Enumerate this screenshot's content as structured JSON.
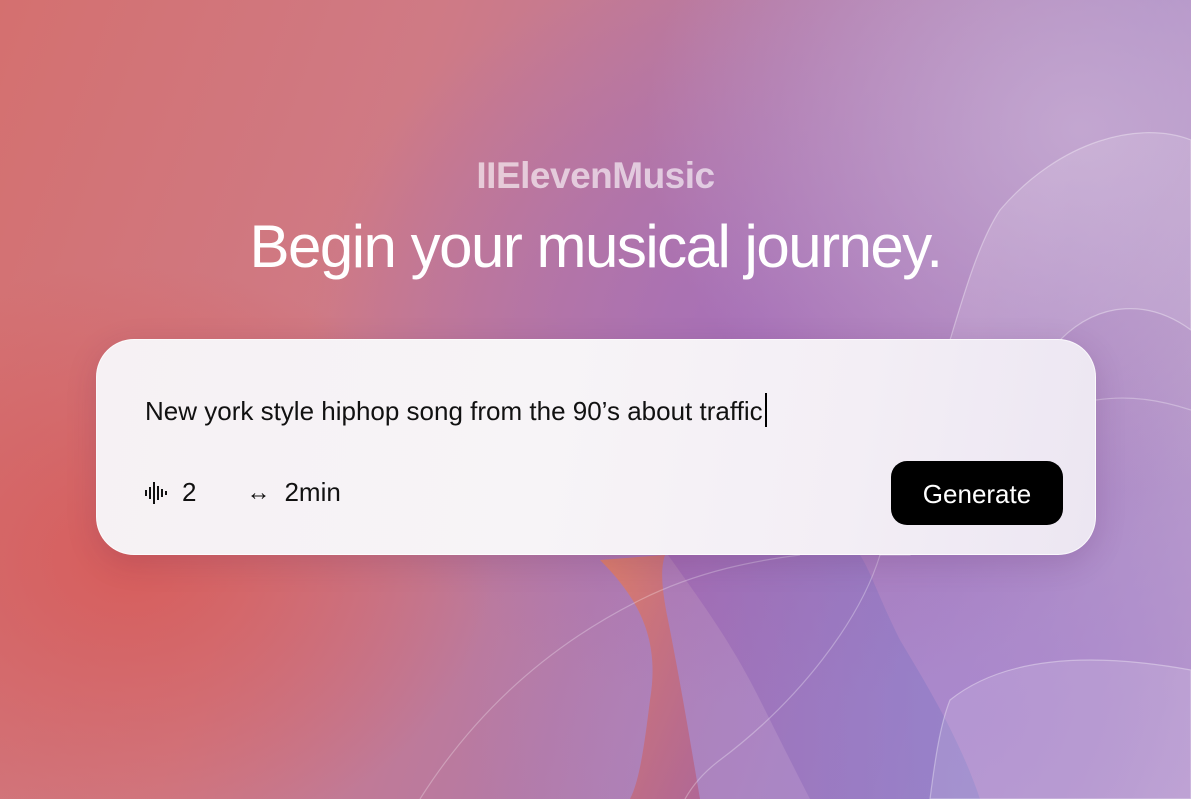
{
  "app": {
    "brand_name": "IIElevenMusic",
    "headline": "Begin your musical journey."
  },
  "prompt_card": {
    "prompt_text": "New york style hiphop song from the 90’s about traffic",
    "variants": {
      "icon": "waveform-icon",
      "value": "2"
    },
    "duration": {
      "icon": "horizontal-arrows-icon",
      "symbol": "↔",
      "value": "2min"
    },
    "generate_label": "Generate"
  },
  "colors": {
    "button_bg": "#000000",
    "button_text": "#ffffff",
    "card_bg": "#f6f1f4",
    "background_left": "#d4706f",
    "background_right": "#a888c2"
  }
}
